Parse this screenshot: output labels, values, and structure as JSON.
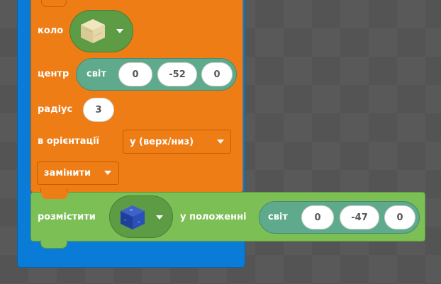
{
  "colors": {
    "workspace": "#595959",
    "loop_block": "#0a7bd6",
    "shape_block": "#ee7d16",
    "position_reporter": "#5faa8c",
    "place_block": "#7cbf55",
    "item_dropdown_green": "#5d9b44",
    "input_pill": "#ffffff"
  },
  "circle_block": {
    "label": "коло",
    "block_icon": "sandstone-block-icon",
    "center_label": "центр",
    "center_position": {
      "label": "світ",
      "x": "0",
      "y": "-52",
      "z": "0"
    },
    "radius_label": "радіус",
    "radius_value": "3",
    "orientation_label": "в орієнтації",
    "orientation_value": "y (верх/низ)",
    "mode_value": "замінити"
  },
  "place_block": {
    "label": "розмістити",
    "block_icon": "lapis-block-icon",
    "position_label": "у положенні",
    "position": {
      "label": "світ",
      "x": "0",
      "y": "-47",
      "z": "0"
    }
  }
}
